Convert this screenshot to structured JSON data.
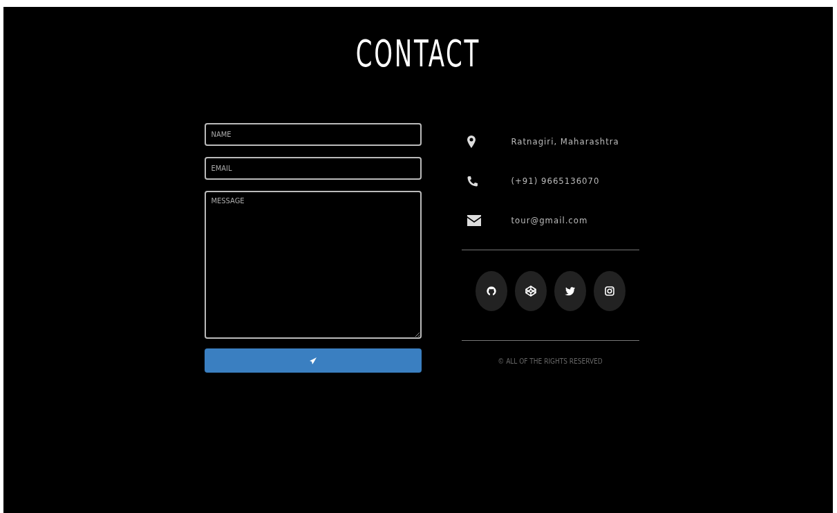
{
  "title": "CONTACT",
  "form": {
    "fields": [
      {
        "kind": "input",
        "placeholder": "NAME"
      },
      {
        "kind": "input",
        "placeholder": "EMAIL"
      },
      {
        "kind": "textarea",
        "placeholder": "MESSAGE"
      }
    ]
  },
  "contact_info": [
    {
      "kind": "location",
      "text": "Ratnagiri, Maharashtra"
    },
    {
      "kind": "phone",
      "text": "(+91) 9665136070"
    },
    {
      "kind": "email",
      "text": "tour@gmail.com"
    }
  ],
  "social_links": [
    {
      "kind": "github"
    },
    {
      "kind": "codepen"
    },
    {
      "kind": "twitter"
    },
    {
      "kind": "instagram"
    }
  ],
  "footer": "© ALL OF THE RIGHTS RESERVED"
}
